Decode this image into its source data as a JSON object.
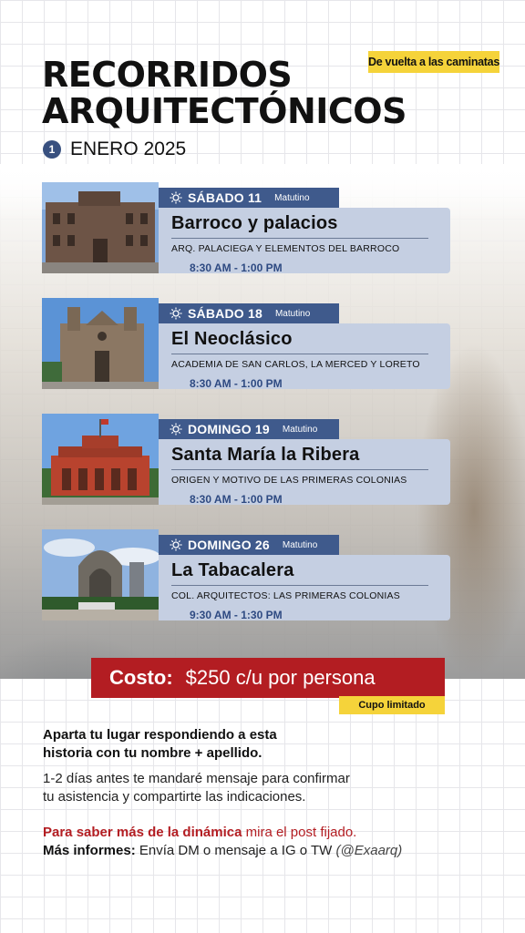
{
  "header": {
    "badge": "De vuelta a las caminatas",
    "title_line1": "RECORRIDOS",
    "title_line2": "ARQUITECTÓNICOS",
    "month_number": "1",
    "month": "ENERO 2025"
  },
  "events": [
    {
      "day": "SÁBADO 11",
      "shift": "Matutino",
      "name": "Barroco y palacios",
      "subtitle": "ARQ. PALACIEGA Y ELEMENTOS DEL BARROCO",
      "time": "8:30 AM - 1:00 PM"
    },
    {
      "day": "SÁBADO 18",
      "shift": "Matutino",
      "name": "El Neoclásico",
      "subtitle": "ACADEMIA DE SAN CARLOS, LA MERCED Y LORETO",
      "time": "8:30 AM - 1:00 PM"
    },
    {
      "day": "DOMINGO 19",
      "shift": "Matutino",
      "name": "Santa María la Ribera",
      "subtitle": "ORIGEN Y MOTIVO DE LAS PRIMERAS COLONIAS",
      "time": "8:30 AM - 1:00 PM"
    },
    {
      "day": "DOMINGO 26",
      "shift": "Matutino",
      "name": "La Tabacalera",
      "subtitle": "COL. ARQUITECTOS: LAS PRIMERAS COLONIAS",
      "time": "9:30 AM - 1:30 PM"
    }
  ],
  "cost": {
    "label": "Costo:",
    "value": "$250 c/u por persona",
    "limited": "Cupo limitado"
  },
  "info": {
    "line1a": "Aparta tu lugar respondiendo a esta",
    "line1b": "historia con tu nombre + apellido.",
    "line2a": "1-2 días antes te mandaré mensaje para confirmar",
    "line2b": "tu asistencia y compartirte las indicaciones.",
    "more_red": "Para saber más de la dinámica",
    "more_rest": " mira el post fijado.",
    "contact_bold": "Más informes:",
    "contact_rest": " Envía DM o mensaje a IG o TW ",
    "handle": "(@Exaarq)"
  },
  "colors": {
    "accent_blue": "#3f5a8c",
    "card_blue": "#c5cfe2",
    "cost_red": "#b31d22",
    "badge_yellow": "#f5d33a"
  }
}
